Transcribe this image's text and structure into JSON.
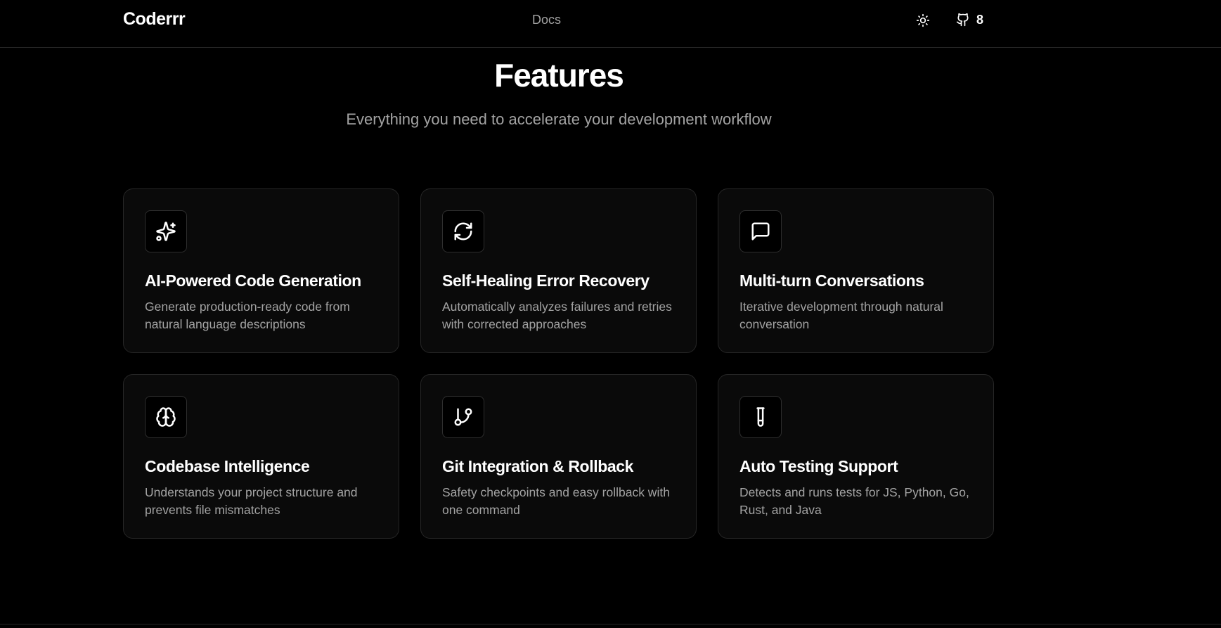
{
  "header": {
    "brand": "Coderrr",
    "nav_docs": "Docs",
    "theme_icon": "sun-icon",
    "github_icon": "github-icon",
    "github_count": "8"
  },
  "hero": {
    "title": "Features",
    "subtitle": "Everything you need to accelerate your development workflow"
  },
  "features": [
    {
      "icon": "sparkles-icon",
      "title": "AI-Powered Code Generation",
      "description": "Generate production-ready code from natural language descriptions"
    },
    {
      "icon": "refresh-icon",
      "title": "Self-Healing Error Recovery",
      "description": "Automatically analyzes failures and retries with corrected approaches"
    },
    {
      "icon": "message-square-icon",
      "title": "Multi-turn Conversations",
      "description": "Iterative development through natural conversation"
    },
    {
      "icon": "brain-icon",
      "title": "Codebase Intelligence",
      "description": "Understands your project structure and prevents file mismatches"
    },
    {
      "icon": "git-branch-icon",
      "title": "Git Integration & Rollback",
      "description": "Safety checkpoints and easy rollback with one command"
    },
    {
      "icon": "test-tube-icon",
      "title": "Auto Testing Support",
      "description": "Detects and runs tests for JS, Python, Go, Rust, and Java"
    }
  ],
  "colors": {
    "background": "#000000",
    "card_background": "#0a0a0a",
    "border": "#262626",
    "muted_text": "#a3a3a3",
    "text": "#ffffff"
  }
}
